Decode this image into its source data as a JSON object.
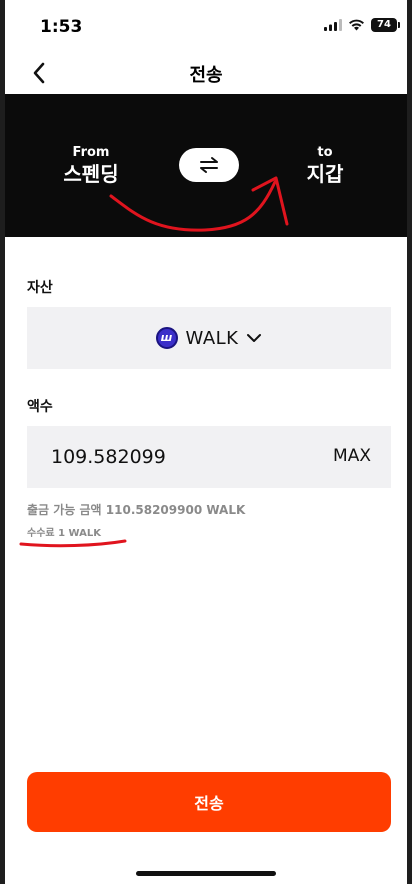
{
  "status_bar": {
    "time": "1:53",
    "battery": "74"
  },
  "nav": {
    "title": "전송"
  },
  "transfer_direction": {
    "from_label": "From",
    "from_value": "스펜딩",
    "to_label": "to",
    "to_value": "지갑"
  },
  "asset": {
    "label": "자산",
    "selected": "WALK",
    "icon_letter": "ш"
  },
  "amount": {
    "label": "액수",
    "value": "109.582099",
    "max_label": "MAX"
  },
  "info": {
    "available": "출금 가능 금액 110.58209900 WALK",
    "fee": "수수료 1 WALK"
  },
  "send_button": {
    "label": "전송"
  },
  "colors": {
    "accent": "#ff3d00",
    "panel": "#0b0b0b",
    "annotation": "#e0141e",
    "field": "#f1f1f3"
  }
}
